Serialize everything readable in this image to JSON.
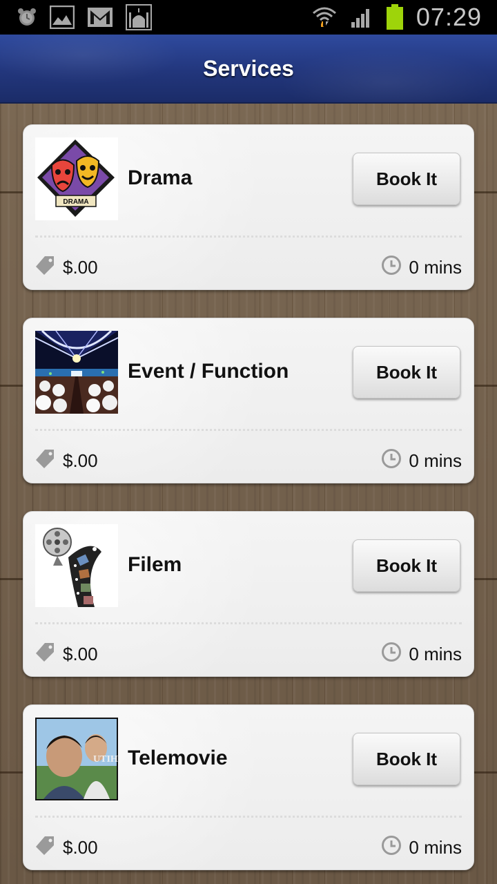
{
  "status_bar": {
    "time": "07:29",
    "left_icons": [
      "alarm-icon",
      "image-icon",
      "gmail-icon",
      "mosque-icon"
    ],
    "right_icons": [
      "wifi-icon",
      "signal-icon",
      "battery-icon"
    ]
  },
  "header": {
    "title": "Services"
  },
  "services": [
    {
      "name": "Drama",
      "button_label": "Book It",
      "price": "$.00",
      "duration": "0 mins",
      "thumbnail": "drama-masks"
    },
    {
      "name": "Event / Function",
      "button_label": "Book It",
      "price": "$.00",
      "duration": "0 mins",
      "thumbnail": "event-hall"
    },
    {
      "name": "Filem",
      "button_label": "Book It",
      "price": "$.00",
      "duration": "0 mins",
      "thumbnail": "film-reel"
    },
    {
      "name": "Telemovie",
      "button_label": "Book It",
      "price": "$.00",
      "duration": "0 mins",
      "thumbnail": "telemovie-still"
    }
  ],
  "colors": {
    "header_blue": "#22367c",
    "battery_green": "#9ed40a",
    "wifi_arrow_orange": "#f0a020"
  }
}
